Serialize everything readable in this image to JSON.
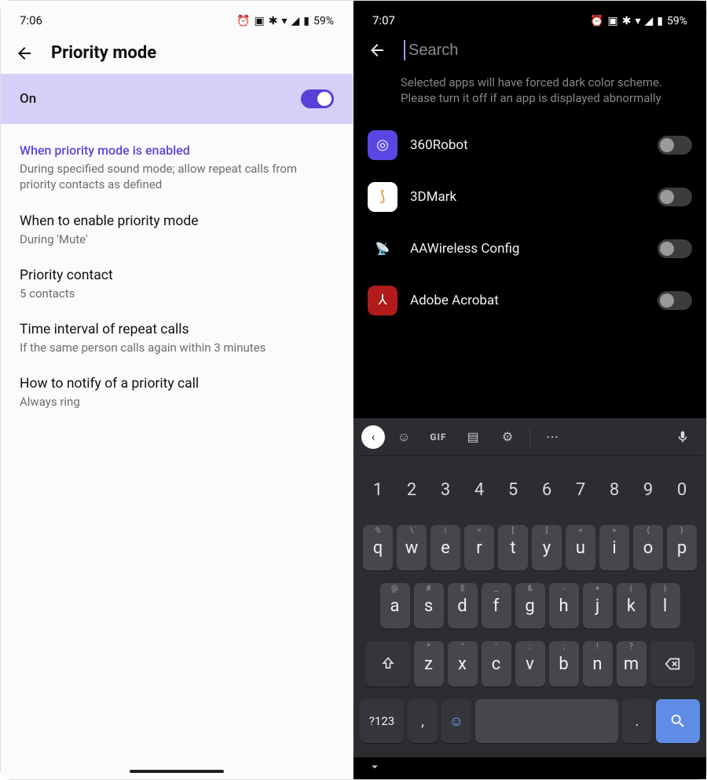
{
  "left": {
    "status": {
      "time": "7:06",
      "battery": "59%"
    },
    "header": {
      "title": "Priority mode"
    },
    "master_toggle": {
      "label": "On"
    },
    "section": {
      "title": "When priority mode is enabled",
      "desc": "During specified sound mode; allow repeat calls from priority contacts as defined"
    },
    "items": [
      {
        "title": "When to enable priority mode",
        "sub": "During 'Mute'"
      },
      {
        "title": "Priority contact",
        "sub": "5 contacts"
      },
      {
        "title": "Time interval of repeat calls",
        "sub": "If the same person calls again within 3 minutes"
      },
      {
        "title": "How to notify of a priority call",
        "sub": "Always ring"
      }
    ]
  },
  "right": {
    "status": {
      "time": "7:07",
      "battery": "59%"
    },
    "search": {
      "placeholder": "Search",
      "value": ""
    },
    "description": "Selected apps will have forced dark color scheme. Please turn it off if an app is displayed abnormally",
    "apps": [
      {
        "name": "360Robot",
        "icon_bg": "#5a47e3",
        "glyph": "◎"
      },
      {
        "name": "3DMark",
        "icon_bg": "#ffffff",
        "glyph": "⟆"
      },
      {
        "name": "AAWireless Config",
        "icon_bg": "#000000",
        "glyph": "📡"
      },
      {
        "name": "Adobe Acrobat",
        "icon_bg": "#b11b1b",
        "glyph": "⅄"
      }
    ]
  },
  "keyboard": {
    "toolbar": {
      "gif_label": "GIF"
    },
    "numbers": [
      "1",
      "2",
      "3",
      "4",
      "5",
      "6",
      "7",
      "8",
      "9",
      "0"
    ],
    "row1": {
      "letters": [
        "q",
        "w",
        "e",
        "r",
        "t",
        "y",
        "u",
        "i",
        "o",
        "p"
      ],
      "hints": [
        "%",
        "\\",
        "|",
        "=",
        "[",
        "]",
        "<",
        ">",
        "{",
        "}"
      ]
    },
    "row2": {
      "letters": [
        "a",
        "s",
        "d",
        "f",
        "g",
        "h",
        "j",
        "k",
        "l"
      ],
      "hints": [
        "@",
        "#",
        "$",
        "_",
        "&",
        "-",
        "+",
        "(",
        ")"
      ]
    },
    "row3": {
      "letters": [
        "z",
        "x",
        "c",
        "v",
        "b",
        "n",
        "m"
      ],
      "hints": [
        "*",
        "\"",
        "'",
        ":",
        ";",
        "!",
        "?"
      ]
    },
    "bottom": {
      "sym": "?123",
      "comma": ",",
      "period": "."
    }
  }
}
